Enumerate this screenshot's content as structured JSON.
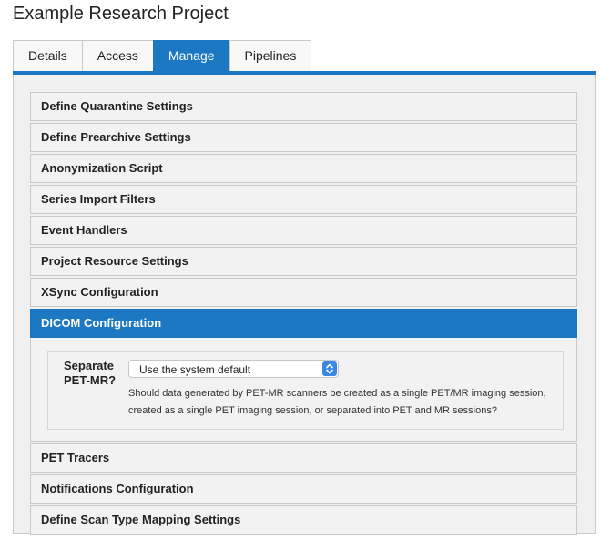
{
  "page": {
    "title": "Example Research Project"
  },
  "tabs": [
    {
      "label": "Details",
      "active": false
    },
    {
      "label": "Access",
      "active": false
    },
    {
      "label": "Manage",
      "active": true
    },
    {
      "label": "Pipelines",
      "active": false
    }
  ],
  "accent_color": "#1c78c2",
  "accordion": {
    "items": [
      {
        "label": "Define Quarantine Settings"
      },
      {
        "label": "Define Prearchive Settings"
      },
      {
        "label": "Anonymization Script"
      },
      {
        "label": "Series Import Filters"
      },
      {
        "label": "Event Handlers"
      },
      {
        "label": "Project Resource Settings"
      },
      {
        "label": "XSync Configuration"
      },
      {
        "label": "DICOM Configuration",
        "expanded": true
      },
      {
        "label": "PET Tracers"
      },
      {
        "label": "Notifications Configuration"
      },
      {
        "label": "Define Scan Type Mapping Settings"
      }
    ],
    "dicom": {
      "setting_label": "Separate PET-MR?",
      "select_value": "Use the system default",
      "select_icon": "updown-chevron-icon",
      "description": "Should data generated by PET-MR scanners be created as a single PET/MR imaging session, created as a single PET imaging session, or separated into PET and MR sessions?"
    }
  }
}
